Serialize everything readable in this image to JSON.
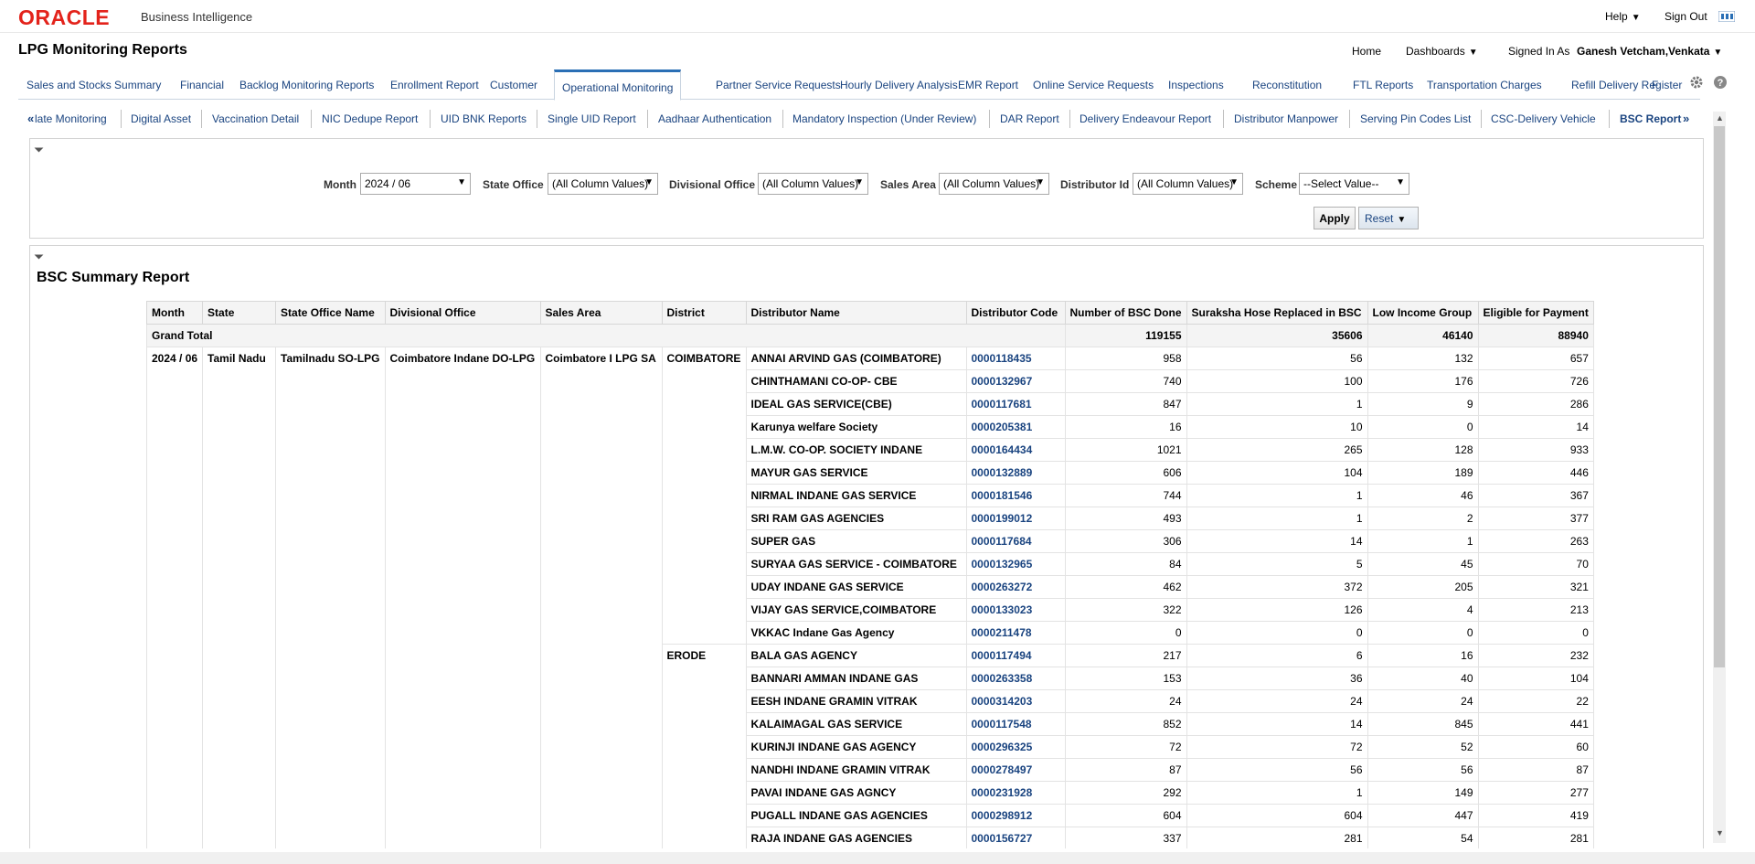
{
  "header": {
    "logo": "ORACLE",
    "product": "Business Intelligence",
    "help": "Help",
    "signout": "Sign Out"
  },
  "titlebar": {
    "title": "LPG Monitoring Reports",
    "home": "Home",
    "dashboards": "Dashboards",
    "signed_in_label": "Signed In As",
    "user": "Ganesh Vetcham,Venkata"
  },
  "tabs": [
    "Sales and Stocks Summary",
    "Financial",
    "Backlog Monitoring Reports",
    "Enrollment Report",
    "Customer",
    "Operational Monitoring",
    "Partner Service Requests",
    "Hourly Delivery Analysis",
    "EMR Report",
    "Online Service Requests",
    "Inspections",
    "Reconstitution",
    "FTL Reports",
    "Transportation Charges",
    "Refill Delivery Register",
    "F"
  ],
  "active_tab": "Operational Monitoring",
  "subtabs": [
    "«",
    "late Monitoring",
    "Digital Asset",
    "Vaccination Detail",
    "NIC Dedupe Report",
    "UID BNK Reports",
    "Single UID Report",
    "Aadhaar Authentication",
    "Mandatory Inspection (Under Review)",
    "DAR Report",
    "Delivery Endeavour Report",
    "Distributor Manpower",
    "Serving Pin Codes List",
    "CSC-Delivery Vehicle",
    "BSC Report",
    "»"
  ],
  "prompts": {
    "month_label": "Month",
    "month_value": "2024 / 06",
    "state_label": "State Office",
    "state_value": "(All Column Values)",
    "div_label": "Divisional Office",
    "div_value": "(All Column Values)",
    "area_label": "Sales Area",
    "area_value": "(All Column Values)",
    "dist_label": "Distributor Id",
    "dist_value": "(All Column Values)",
    "scheme_label": "Scheme",
    "scheme_value": "--Select Value--",
    "apply": "Apply",
    "reset": "Reset"
  },
  "report": {
    "title": "BSC Summary Report",
    "headers": [
      "Month",
      "State",
      "State Office Name",
      "Divisional Office",
      "Sales Area",
      "District",
      "Distributor Name",
      "Distributor Code",
      "Number of BSC Done",
      "Suraksha Hose Replaced in BSC",
      "Low Income Group",
      "Eligible for Payment"
    ],
    "grand_total": {
      "label": "Grand Total",
      "bsc": "119155",
      "hose": "35606",
      "low": "46140",
      "eligible": "88940"
    },
    "group": {
      "month": "2024 / 06",
      "state": "Tamil Nadu",
      "state_office": "Tamilnadu SO-LPG",
      "divisional": "Coimbatore Indane DO-LPG",
      "sales_area": "Coimbatore I LPG SA"
    },
    "districts": [
      {
        "name": "COIMBATORE",
        "rows": [
          [
            "ANNAI ARVIND GAS (COIMBATORE)",
            "0000118435",
            "958",
            "56",
            "132",
            "657"
          ],
          [
            "CHINTHAMANI CO-OP- CBE",
            "0000132967",
            "740",
            "100",
            "176",
            "726"
          ],
          [
            "IDEAL GAS SERVICE(CBE)",
            "0000117681",
            "847",
            "1",
            "9",
            "286"
          ],
          [
            "Karunya welfare Society",
            "0000205381",
            "16",
            "10",
            "0",
            "14"
          ],
          [
            "L.M.W. CO-OP. SOCIETY INDANE",
            "0000164434",
            "1021",
            "265",
            "128",
            "933"
          ],
          [
            "MAYUR GAS SERVICE",
            "0000132889",
            "606",
            "104",
            "189",
            "446"
          ],
          [
            "NIRMAL INDANE GAS SERVICE",
            "0000181546",
            "744",
            "1",
            "46",
            "367"
          ],
          [
            "SRI RAM GAS AGENCIES",
            "0000199012",
            "493",
            "1",
            "2",
            "377"
          ],
          [
            "SUPER GAS",
            "0000117684",
            "306",
            "14",
            "1",
            "263"
          ],
          [
            "SURYAA GAS SERVICE - COIMBATORE",
            "0000132965",
            "84",
            "5",
            "45",
            "70"
          ],
          [
            "UDAY INDANE GAS SERVICE",
            "0000263272",
            "462",
            "372",
            "205",
            "321"
          ],
          [
            "VIJAY GAS SERVICE,COIMBATORE",
            "0000133023",
            "322",
            "126",
            "4",
            "213"
          ],
          [
            "VKKAC Indane Gas Agency",
            "0000211478",
            "0",
            "0",
            "0",
            "0"
          ]
        ]
      },
      {
        "name": "ERODE",
        "rows": [
          [
            "BALA GAS AGENCY",
            "0000117494",
            "217",
            "6",
            "16",
            "232"
          ],
          [
            "BANNARI AMMAN INDANE GAS",
            "0000263358",
            "153",
            "36",
            "40",
            "104"
          ],
          [
            "EESH INDANE GRAMIN VITRAK",
            "0000314203",
            "24",
            "24",
            "24",
            "22"
          ],
          [
            "KALAIMAGAL GAS SERVICE",
            "0000117548",
            "852",
            "14",
            "845",
            "441"
          ],
          [
            "KURINJI INDANE GAS AGENCY",
            "0000296325",
            "72",
            "72",
            "52",
            "60"
          ],
          [
            "NANDHI INDANE GRAMIN VITRAK",
            "0000278497",
            "87",
            "56",
            "56",
            "87"
          ],
          [
            "PAVAI INDANE GAS AGNCY",
            "0000231928",
            "292",
            "1",
            "149",
            "277"
          ],
          [
            "PUGALL INDANE GAS AGENCIES",
            "0000298912",
            "604",
            "604",
            "447",
            "419"
          ],
          [
            "RAJA INDANE GAS AGENCIES",
            "0000156727",
            "337",
            "281",
            "54",
            "281"
          ]
        ]
      }
    ]
  }
}
